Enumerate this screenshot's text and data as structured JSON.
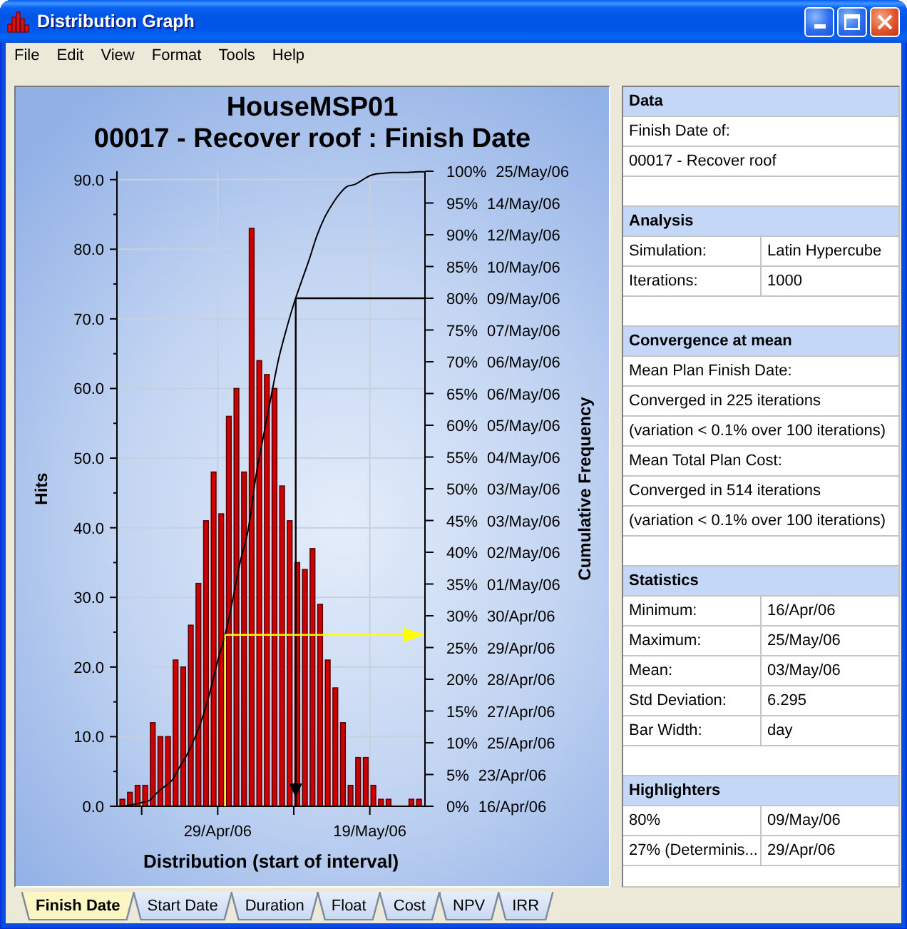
{
  "window": {
    "title": "Distribution Graph"
  },
  "menu": [
    "File",
    "Edit",
    "View",
    "Format",
    "Tools",
    "Help"
  ],
  "chart": {
    "subtitle": "00017 - Recover roof : Finish Date",
    "chart_data": {
      "type": "bar",
      "title": "HouseMSP01",
      "xlabel": "Distribution (start of interval)",
      "ylabel": "Hits",
      "categories": [
        null,
        null,
        null,
        null,
        null,
        null,
        null,
        null,
        null,
        null,
        null,
        null,
        null,
        "29/Apr/06",
        null,
        null,
        null,
        null,
        null,
        null,
        null,
        null,
        null,
        null,
        null,
        null,
        null,
        null,
        null,
        null,
        null,
        null,
        null,
        "19/May/06",
        null,
        null,
        null,
        null,
        null,
        null
      ],
      "series": [
        {
          "color": "#d00000",
          "values": [
            1,
            2,
            3,
            3,
            12,
            10,
            10,
            21,
            20,
            26,
            32,
            41,
            48,
            42,
            56,
            60,
            48,
            83,
            64,
            62,
            60,
            46,
            41,
            35,
            34,
            37,
            29,
            21,
            17,
            12,
            3,
            7,
            7,
            3,
            1,
            1,
            0,
            0,
            1,
            1
          ]
        }
      ],
      "ylim": [
        0,
        91.2
      ],
      "grid": true,
      "yticks": [
        {
          "value": 0,
          "label": "0.0"
        },
        {
          "value": 10,
          "label": "10.0"
        },
        {
          "value": 20,
          "label": "20.0"
        },
        {
          "value": 30,
          "label": "30.0"
        },
        {
          "value": 40,
          "label": "40.0"
        },
        {
          "value": 50,
          "label": "50.0"
        },
        {
          "value": 60,
          "label": "60.0"
        },
        {
          "value": 70,
          "label": "70.0"
        },
        {
          "value": 80,
          "label": "80.0"
        },
        {
          "value": 90,
          "label": "90.0"
        }
      ]
    }
  },
  "cumulative_chart": {
    "chart_data": {
      "type": "line",
      "ylabel": "Cumulative Frequency",
      "categories": [
        null,
        null,
        null,
        null,
        null,
        null,
        null,
        null,
        null,
        null,
        null,
        null,
        null,
        null,
        null,
        null,
        null,
        null,
        null,
        null,
        null,
        null,
        null,
        null,
        null,
        null,
        null,
        null,
        null,
        null,
        null,
        null,
        null,
        null,
        null,
        null,
        null,
        null,
        null,
        null
      ],
      "series": [
        {
          "color": "#000000",
          "values": [
            0,
            0.1,
            0.3,
            0.6,
            0.9,
            2.1,
            3.1,
            4.1,
            6.2,
            8.2,
            10.8,
            14,
            18.1,
            22.9,
            27.1,
            32.7,
            38.7,
            43.5,
            51.8,
            58.2,
            64.4,
            70.4,
            75,
            79.1,
            82.6,
            86,
            89.7,
            92.6,
            94.7,
            96.4,
            97.6,
            97.9,
            98.6,
            99.3,
            99.6,
            99.7,
            99.8,
            99.8,
            99.8,
            99.9
          ]
        }
      ],
      "ylim": [
        0,
        100
      ],
      "yticks": [
        {
          "value": 100,
          "label": "100%"
        },
        {
          "value": 95,
          "label": "95%"
        },
        {
          "value": 90,
          "label": "90%"
        },
        {
          "value": 85,
          "label": "85%"
        },
        {
          "value": 80,
          "label": "80%"
        },
        {
          "value": 75,
          "label": "75%"
        },
        {
          "value": 70,
          "label": "70%"
        },
        {
          "value": 65,
          "label": "65%"
        },
        {
          "value": 60,
          "label": "60%"
        },
        {
          "value": 55,
          "label": "55%"
        },
        {
          "value": 50,
          "label": "50%"
        },
        {
          "value": 45,
          "label": "45%"
        },
        {
          "value": 40,
          "label": "40%"
        },
        {
          "value": 35,
          "label": "35%"
        },
        {
          "value": 30,
          "label": "30%"
        },
        {
          "value": 25,
          "label": "25%"
        },
        {
          "value": 20,
          "label": "20%"
        },
        {
          "value": 15,
          "label": "15%"
        },
        {
          "value": 10,
          "label": "10%"
        },
        {
          "value": 5,
          "label": "5%"
        },
        {
          "value": 0,
          "label": "0%"
        }
      ],
      "ref_lines": [
        {
          "axis": "y",
          "value": 80,
          "color": "#000000"
        },
        {
          "axis": "y",
          "value": 27,
          "color": "#ffff00"
        }
      ]
    },
    "highlighter_arrows": [
      {
        "kind": "down"
      },
      {
        "kind": "right"
      }
    ],
    "percentile_dates": [
      "25/May/06",
      "14/May/06",
      "12/May/06",
      "10/May/06",
      "09/May/06",
      "07/May/06",
      "06/May/06",
      "06/May/06",
      "05/May/06",
      "04/May/06",
      "03/May/06",
      "03/May/06",
      "02/May/06",
      "01/May/06",
      "30/Apr/06",
      "29/Apr/06",
      "28/Apr/06",
      "27/Apr/06",
      "25/Apr/06",
      "23/Apr/06",
      "16/Apr/06"
    ]
  },
  "panel": {
    "sections": [
      {
        "title": "Data",
        "rows": [
          [
            "Finish Date of:"
          ],
          [
            "00017 - Recover roof"
          ]
        ]
      },
      {
        "title": "Analysis",
        "rows": [
          [
            "Simulation:",
            "Latin Hypercube"
          ],
          [
            "Iterations:",
            "1000"
          ]
        ]
      },
      {
        "title": "Convergence at mean",
        "rows": [
          [
            "Mean Plan Finish Date:"
          ],
          [
            "Converged in 225 iterations"
          ],
          [
            "(variation < 0.1% over 100 iterations)"
          ],
          [
            "Mean Total Plan Cost:"
          ],
          [
            "Converged in 514 iterations"
          ],
          [
            "(variation < 0.1% over 100 iterations)"
          ]
        ]
      },
      {
        "title": "Statistics",
        "rows": [
          [
            "Minimum:",
            "16/Apr/06"
          ],
          [
            "Maximum:",
            "25/May/06"
          ],
          [
            "Mean:",
            "03/May/06"
          ],
          [
            "Std Deviation:",
            "6.295"
          ],
          [
            "Bar Width:",
            "day"
          ]
        ]
      },
      {
        "title": "Highlighters",
        "rows": [
          [
            "80%",
            "09/May/06"
          ],
          [
            "27% (Determinis...",
            "29/Apr/06"
          ]
        ]
      }
    ]
  },
  "tabs": [
    {
      "label": "Finish Date",
      "selected": true
    },
    {
      "label": "Start Date",
      "selected": false
    },
    {
      "label": "Duration",
      "selected": false
    },
    {
      "label": "Float",
      "selected": false
    },
    {
      "label": "Cost",
      "selected": false
    },
    {
      "label": "NPV",
      "selected": false
    },
    {
      "label": "IRR",
      "selected": false
    }
  ]
}
